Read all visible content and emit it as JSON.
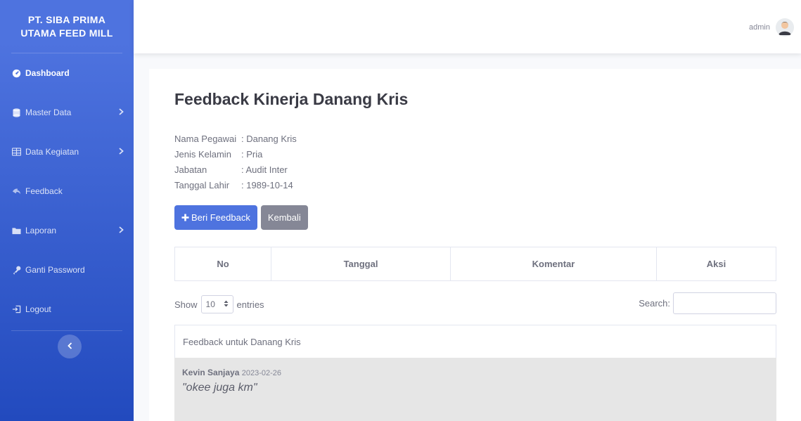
{
  "brand": {
    "line1": "PT. SIBA PRIMA",
    "line2": "UTAMA FEED MILL"
  },
  "sidebar": {
    "items": [
      {
        "label": "Dashboard",
        "icon": "dashboard-icon"
      },
      {
        "label": "Master Data",
        "icon": "database-icon"
      },
      {
        "label": "Data Kegiatan",
        "icon": "table-icon"
      },
      {
        "label": "Feedback",
        "icon": "feedback-icon"
      },
      {
        "label": "Laporan",
        "icon": "folder-icon"
      },
      {
        "label": "Ganti Password",
        "icon": "key-icon"
      },
      {
        "label": "Logout",
        "icon": "logout-icon"
      }
    ]
  },
  "topbar": {
    "user": "admin"
  },
  "page": {
    "title": "Feedback Kinerja Danang Kris",
    "info": [
      {
        "label": "Nama Pegawai",
        "value": ": Danang Kris"
      },
      {
        "label": "Jenis Kelamin",
        "value": ": Pria"
      },
      {
        "label": "Jabatan",
        "value": ": Audit Inter"
      },
      {
        "label": "Tanggal Lahir",
        "value": ": 1989-10-14"
      }
    ],
    "btn_feedback": "Beri Feedback",
    "btn_back": "Kembali"
  },
  "table": {
    "columns": [
      "No",
      "Tanggal",
      "Komentar",
      "Aksi"
    ],
    "show_label": "Show",
    "entries_value": "10",
    "entries_label": "entries",
    "search_label": "Search:"
  },
  "feedback": {
    "header": "Feedback untuk Danang Kris",
    "author": "Kevin Sanjaya",
    "date": "2023-02-26",
    "comment": "\"okee juga km\""
  },
  "colors": {
    "primary": "#4e73df",
    "secondary": "#858796"
  }
}
